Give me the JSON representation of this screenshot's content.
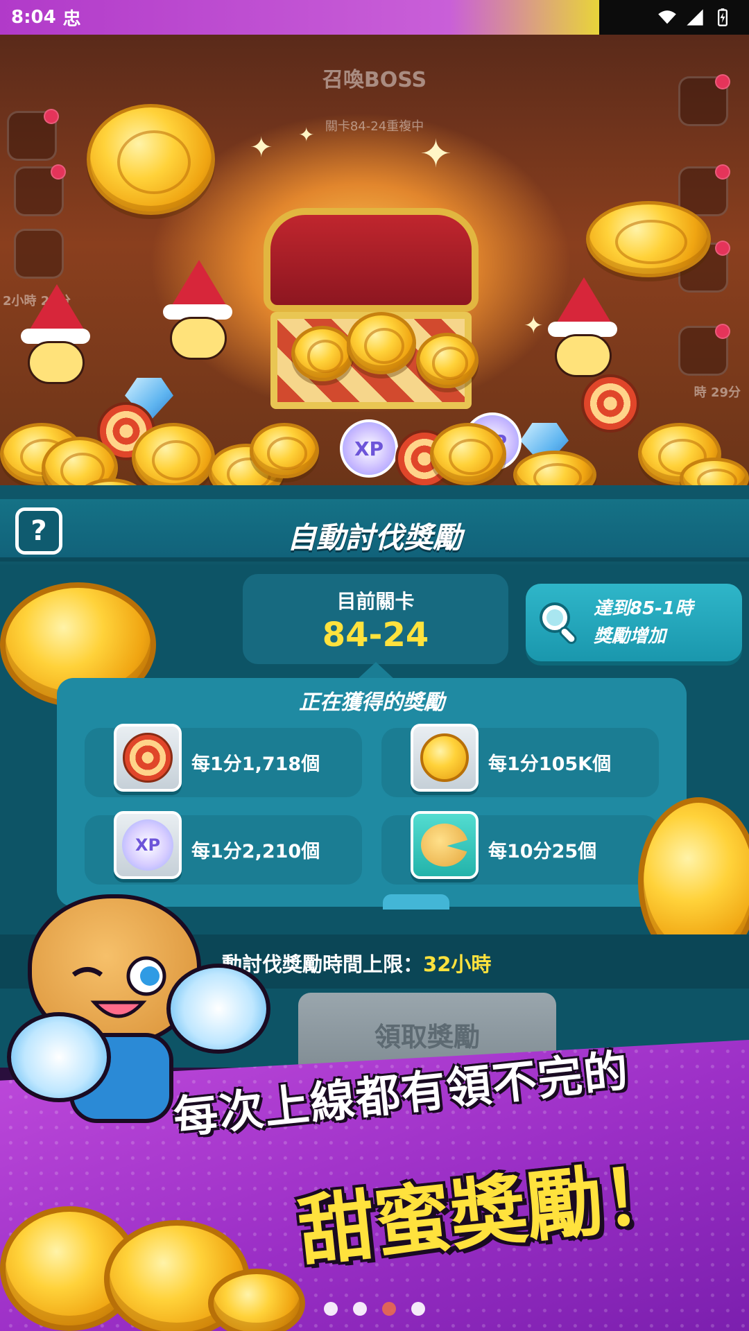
{
  "status_bar": {
    "time": "8:04",
    "notification_glyph": "忠",
    "icons": [
      "wifi-icon",
      "signal-icon",
      "battery-icon"
    ]
  },
  "scene": {
    "boss_title": "召喚BOSS",
    "boss_subtitle": "關卡84-24重複中",
    "left_timer": "2小時 29分",
    "right_timer": "時 29分"
  },
  "panel": {
    "help_label": "?",
    "title": "自動討伐獎勵",
    "current_stage_label": "目前關卡",
    "current_stage_value": "84-24",
    "boost_line1": "達到85-1時",
    "boost_line2": "獎勵增加",
    "rewards_title": "正在獲得的獎勵",
    "rewards": [
      {
        "icon": "target-icon",
        "text": "每1分1,718個"
      },
      {
        "icon": "coin-icon",
        "text": "每1分105K個"
      },
      {
        "icon": "xp-icon",
        "text": "每1分2,210個"
      },
      {
        "icon": "cookie-icon",
        "text": "每10分25個"
      }
    ],
    "limit_label": "動討伐獎勵時間上限：",
    "limit_value": "32小時",
    "claim_button": "領取獎勵"
  },
  "promo": {
    "line1": "每次上線都有領不完的",
    "line2": "甜蜜獎勵！"
  },
  "pager": {
    "count": 4,
    "active_index": 2
  },
  "colors": {
    "accent_yellow": "#ffe23d",
    "panel_teal": "#0f5668",
    "promo_purple": "#9b2fc6"
  }
}
